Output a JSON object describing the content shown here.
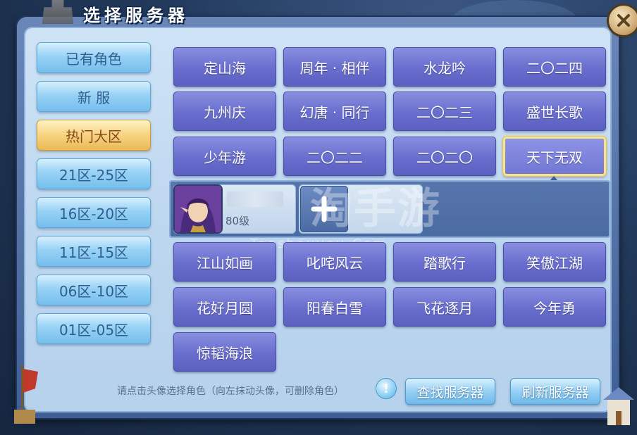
{
  "window": {
    "title": "选择服务器"
  },
  "sidebar": {
    "tabs": [
      {
        "label": "已有角色",
        "active": false
      },
      {
        "label": "新 服",
        "active": false
      },
      {
        "label": "热门大区",
        "active": true
      },
      {
        "label": "21区-25区",
        "active": false
      },
      {
        "label": "16区-20区",
        "active": false
      },
      {
        "label": "11区-15区",
        "active": false
      },
      {
        "label": "06区-10区",
        "active": false
      },
      {
        "label": "01区-05区",
        "active": false
      }
    ]
  },
  "servers": {
    "rows_top": [
      [
        "定山海",
        "周年 · 相伴",
        "水龙吟",
        "二〇二四"
      ],
      [
        "九州庆",
        "幻唐 · 同行",
        "二〇二三",
        "盛世长歌"
      ],
      [
        "少年游",
        "二〇二二",
        "二〇二〇",
        "天下无双"
      ]
    ],
    "selected": "天下无双",
    "rows_bottom": [
      [
        "江山如画",
        "叱咤风云",
        "踏歌行",
        "笑傲江湖"
      ],
      [
        "花好月圆",
        "阳春白雪",
        "飞花逐月",
        "今年勇"
      ],
      [
        "惊韬海浪"
      ]
    ]
  },
  "character": {
    "level": "80级"
  },
  "watermark": {
    "text": "淘手游",
    "url": "Taoshouyou.Com"
  },
  "footer": {
    "hint": "请点击头像选择角色（向左抹动头像，可删除角色）",
    "find_button": "查找服务器",
    "refresh_button": "刷新服务器"
  },
  "colors": {
    "server_button": "#6b70cf",
    "active_tab": "#f6d37f",
    "tab": "#98d2f5",
    "selected_border": "#f7e48c"
  }
}
